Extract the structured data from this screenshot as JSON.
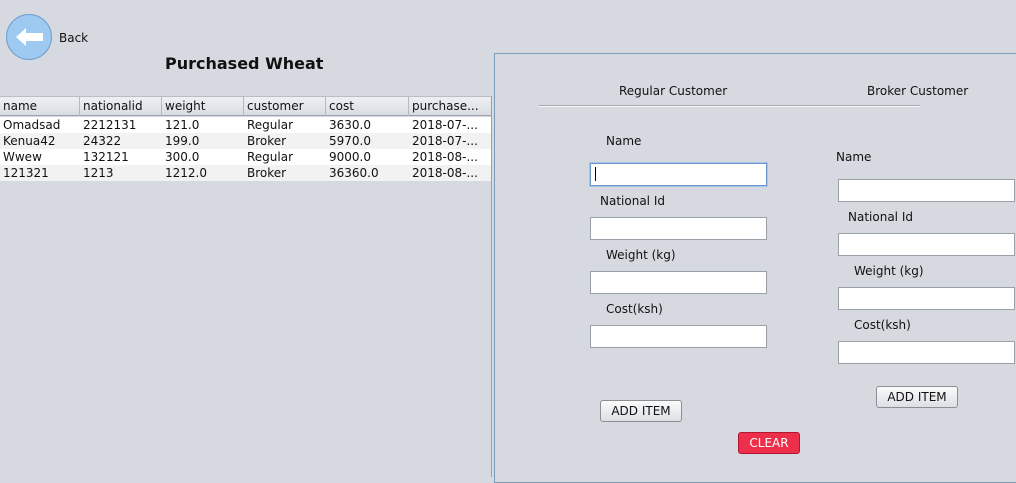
{
  "nav": {
    "back_label": "Back"
  },
  "title": "Purchased Wheat",
  "table": {
    "columns": [
      "name",
      "nationalid",
      "weight",
      "customer",
      "cost",
      "purchase..."
    ],
    "rows": [
      [
        "Omadsad",
        "2212131",
        "121.0",
        "Regular",
        "3630.0",
        "2018-07-..."
      ],
      [
        "Kenua42",
        "24322",
        "199.0",
        "Broker",
        "5970.0",
        "2018-07-..."
      ],
      [
        "Wwew",
        "132121",
        "300.0",
        "Regular",
        "9000.0",
        "2018-08-..."
      ],
      [
        "121321",
        "1213",
        "1212.0",
        "Broker",
        "36360.0",
        "2018-08-..."
      ]
    ]
  },
  "regular": {
    "header": "Regular Customer",
    "name_label": "Name",
    "nationalid_label": "National Id",
    "weight_label": "Weight (kg)",
    "cost_label": "Cost(ksh)",
    "name_value": "",
    "nationalid_value": "",
    "weight_value": "",
    "cost_value": "",
    "add_label": "ADD ITEM"
  },
  "broker": {
    "header": "Broker Customer",
    "name_label": "Name",
    "nationalid_label": "National Id",
    "weight_label": "Weight (kg)",
    "cost_label": "Cost(ksh)",
    "name_value": "",
    "nationalid_value": "",
    "weight_value": "",
    "cost_value": "",
    "add_label": "ADD ITEM"
  },
  "clear_label": "CLEAR",
  "colors": {
    "back_button": "#9ec9f1",
    "clear_button": "#ee2f4b",
    "panel_border": "#7f9db9"
  },
  "icons": {
    "back": "arrow-left-icon"
  }
}
